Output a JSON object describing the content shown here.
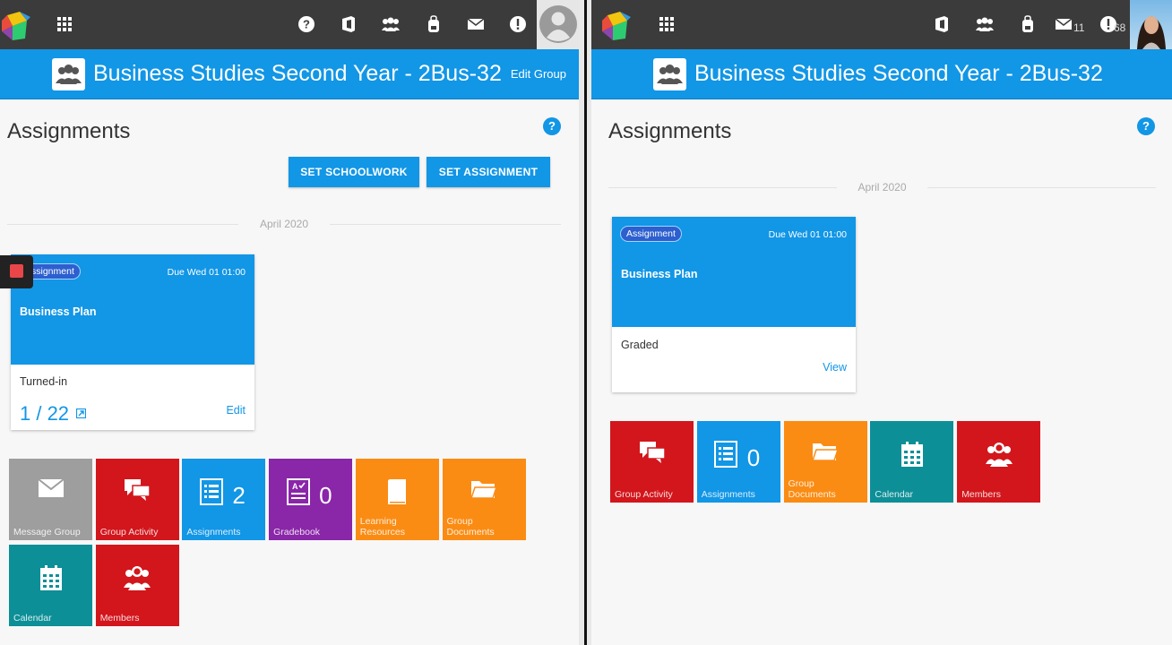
{
  "left": {
    "group_title": "Business Studies Second Year - 2Bus-32",
    "edit_group": "Edit Group",
    "page_title": "Assignments",
    "help": "?",
    "buttons": {
      "set_schoolwork": "SET SCHOOLWORK",
      "set_assignment": "SET ASSIGNMENT"
    },
    "month": "April 2020",
    "card": {
      "badge": "Assignment",
      "due": "Due Wed 01 01:00",
      "title": "Business Plan",
      "status": "Turned-in",
      "count": "1 / 22",
      "action": "Edit"
    },
    "tiles": [
      {
        "label": "Message Group",
        "color": "#9e9e9e",
        "icon": "envelope-icon"
      },
      {
        "label": "Group Activity",
        "color": "#d2161c",
        "icon": "chat-icon"
      },
      {
        "label": "Assignments",
        "color": "#1296e6",
        "icon": "list-icon",
        "count": "2"
      },
      {
        "label": "Gradebook",
        "color": "#8a26a8",
        "icon": "gradebook-icon",
        "count": "0"
      },
      {
        "label": "Learning Resources",
        "color": "#fa8c14",
        "icon": "book-icon"
      },
      {
        "label": "Group Documents",
        "color": "#fa8c14",
        "icon": "folder-icon"
      },
      {
        "label": "Calendar",
        "color": "#0d8f97",
        "icon": "calendar-icon"
      },
      {
        "label": "Members",
        "color": "#d2161c",
        "icon": "members-icon"
      }
    ]
  },
  "right": {
    "group_title": "Business Studies Second Year - 2Bus-32",
    "page_title": "Assignments",
    "help": "?",
    "month": "April 2020",
    "messages_count": "11",
    "alerts_count": "68",
    "card": {
      "badge": "Assignment",
      "due": "Due Wed 01 01:00",
      "title": "Business Plan",
      "status": "Graded",
      "action": "View"
    },
    "tiles": [
      {
        "label": "Group Activity",
        "color": "#d2161c",
        "icon": "chat-icon"
      },
      {
        "label": "Assignments",
        "color": "#1296e6",
        "icon": "list-icon",
        "count": "0"
      },
      {
        "label": "Group Documents",
        "color": "#fa8c14",
        "icon": "folder-icon"
      },
      {
        "label": "Calendar",
        "color": "#0d8f97",
        "icon": "calendar-icon"
      },
      {
        "label": "Members",
        "color": "#d2161c",
        "icon": "members-icon"
      }
    ]
  }
}
